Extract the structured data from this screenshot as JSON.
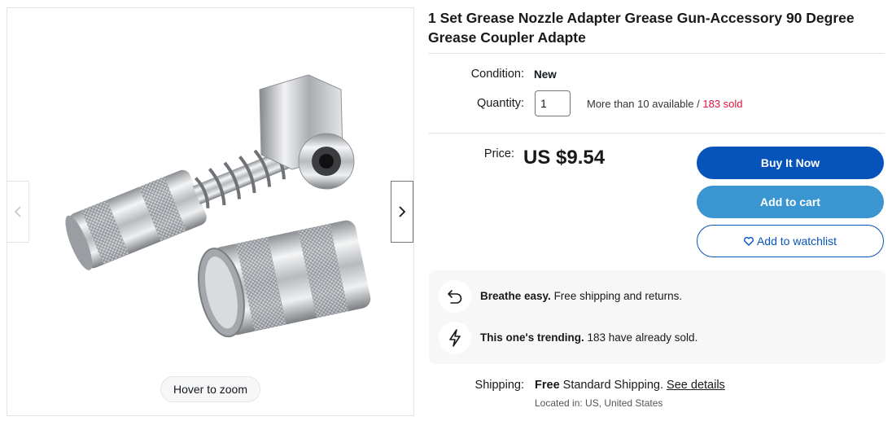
{
  "gallery": {
    "zoom_hint": "Hover to zoom",
    "prev_icon": "chevron-left-icon",
    "next_icon": "chevron-right-icon"
  },
  "listing": {
    "title": "1 Set Grease Nozzle Adapter Grease Gun-Accessory 90 Degree Grease Coupler Adapte",
    "condition_label": "Condition:",
    "condition_value": "New",
    "quantity_label": "Quantity:",
    "quantity_value": "1",
    "availability": "More than 10 available",
    "availability_sep": " / ",
    "sold": "183 sold",
    "price_label": "Price:",
    "price": "US $9.54"
  },
  "actions": {
    "buy_now": "Buy It Now",
    "add_to_cart": "Add to cart",
    "watchlist": "Add to watchlist"
  },
  "highlights": [
    {
      "icon": "return-arrow-icon",
      "strong": "Breathe easy.",
      "text": " Free shipping and returns."
    },
    {
      "icon": "lightning-icon",
      "strong": "This one's trending.",
      "text": " 183 have already sold."
    }
  ],
  "shipping": {
    "label": "Shipping:",
    "free": "Free",
    "method": " Standard Shipping. ",
    "details_link": "See details",
    "location": "Located in: US, United States"
  },
  "colors": {
    "primary": "#0654ba",
    "secondary": "#3a95d0",
    "sold_red": "#e0103a"
  }
}
